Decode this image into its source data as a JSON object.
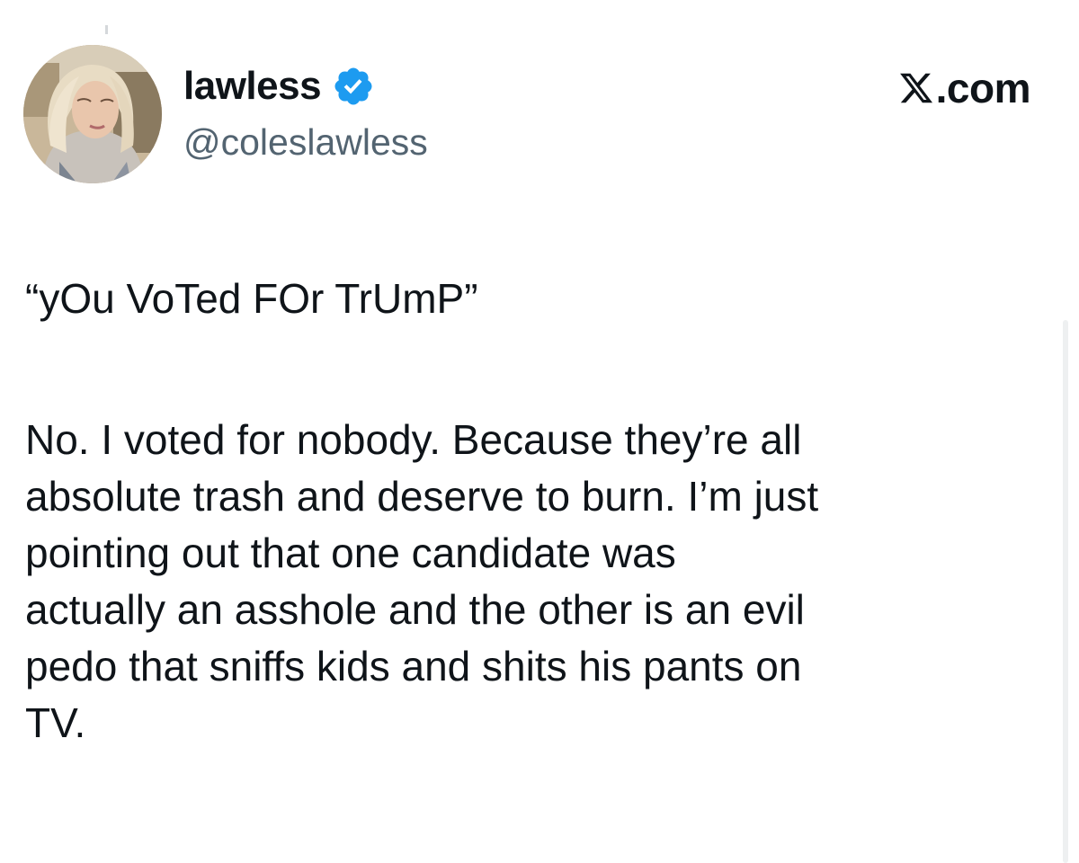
{
  "tweet": {
    "display_name": "lawless",
    "handle": "@coleslawless",
    "verified": true,
    "source_brand": ".com",
    "quote_line": "“yOu VoTed FOr TrUmP”",
    "body_lines": [
      "No. I voted for nobody. Because they’re all",
      "absolute trash and deserve to burn. I’m just",
      "pointing out that one candidate was",
      "actually an asshole and the other is an evil",
      "pedo that sniffs kids and shits his pants on",
      "TV."
    ]
  },
  "icons": {
    "verified": "verified-badge-icon",
    "brand": "x-logo-icon",
    "avatar": "profile-photo"
  },
  "colors": {
    "verified_blue": "#1d9bf0",
    "text_primary": "#0f1419",
    "text_secondary": "#536471"
  }
}
